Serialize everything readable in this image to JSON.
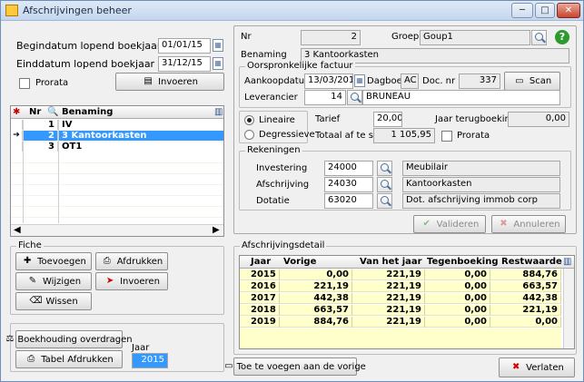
{
  "window": {
    "title": "Afschrijvingen beheer",
    "min": "─",
    "max": "□",
    "close": "✕"
  },
  "left": {
    "begin_label": "Begindatum lopend boekjaar",
    "begin_value": "01/01/15",
    "end_label": "Einddatum lopend boekjaar",
    "end_value": "31/12/15",
    "prorata_label": "Prorata",
    "invoeren_label": "Invoeren",
    "grid_headers": {
      "nr": "Nr",
      "benaming": "Benaming"
    },
    "grid_rows": [
      {
        "nr": "1",
        "name": "IV"
      },
      {
        "nr": "2",
        "name": "3 Kantoorkasten"
      },
      {
        "nr": "3",
        "name": "OT1"
      }
    ],
    "fiche_title": "Fiche",
    "toevoegen": "Toevoegen",
    "afdrukken": "Afdrukken",
    "wijzigen": "Wijzigen",
    "invoeren2": "Invoeren",
    "wissen": "Wissen",
    "boekhouding": "Boekhouding overdragen",
    "tabel": "Tabel Afdrukken",
    "jaar_label": "Jaar",
    "jaar_value": "2015"
  },
  "detail": {
    "nr_label": "Nr",
    "nr_value": "2",
    "groep_label": "Groep",
    "groep_value": "Goup1",
    "benaming_label": "Benaming",
    "benaming_value": "3 Kantoorkasten",
    "orig_title": "Oorspronkelijke factuur",
    "aankoop_label": "Aankoopdatum",
    "aankoop_value": "13/03/2015",
    "dagboek_label": "Dagboek",
    "dagboek_value": "AC",
    "docnr_label": "Doc. nr",
    "docnr_value": "337",
    "scan_label": "Scan",
    "lev_label": "Leverancier",
    "lev_code": "14",
    "lev_name": "BRUNEAU",
    "lineaire": "Lineaire",
    "degressieve": "Degressieve",
    "tarief_label": "Tarief",
    "tarief_value": "20,00",
    "jaarterug_label": "Jaar terugboeking",
    "jaarterug_value": "0,00",
    "totaal_label": "Totaal af te schri",
    "totaal_value": "1 105,95",
    "prorata_label": "Prorata",
    "rek_title": "Rekeningen",
    "rek": [
      {
        "label": "Investering",
        "code": "24000",
        "name": "Meubilair"
      },
      {
        "label": "Afschrijving",
        "code": "24030",
        "name": "Kantoorkasten"
      },
      {
        "label": "Dotatie",
        "code": "63020",
        "name": "Dot. afschrijving immob corp"
      }
    ],
    "valideren": "Valideren",
    "annuleren": "Annuleren"
  },
  "schedule": {
    "title": "Afschrijvingsdetail",
    "headers": {
      "jaar": "Jaar",
      "vorige": "Vorige",
      "van": "Van het jaar",
      "terug": "Tegenboeking",
      "rest": "Restwaarde"
    },
    "rows": [
      {
        "jaar": "2015",
        "vorige": "0,00",
        "van": "221,19",
        "terug": "0,00",
        "rest": "884,76"
      },
      {
        "jaar": "2016",
        "vorige": "221,19",
        "van": "221,19",
        "terug": "0,00",
        "rest": "663,57"
      },
      {
        "jaar": "2017",
        "vorige": "442,38",
        "van": "221,19",
        "terug": "0,00",
        "rest": "442,38"
      },
      {
        "jaar": "2018",
        "vorige": "663,57",
        "van": "221,19",
        "terug": "0,00",
        "rest": "221,19"
      },
      {
        "jaar": "2019",
        "vorige": "884,76",
        "van": "221,19",
        "terug": "0,00",
        "rest": "0,00"
      }
    ],
    "toe_label": "Toe te voegen aan de vorige",
    "verlaten": "Verlaten"
  }
}
